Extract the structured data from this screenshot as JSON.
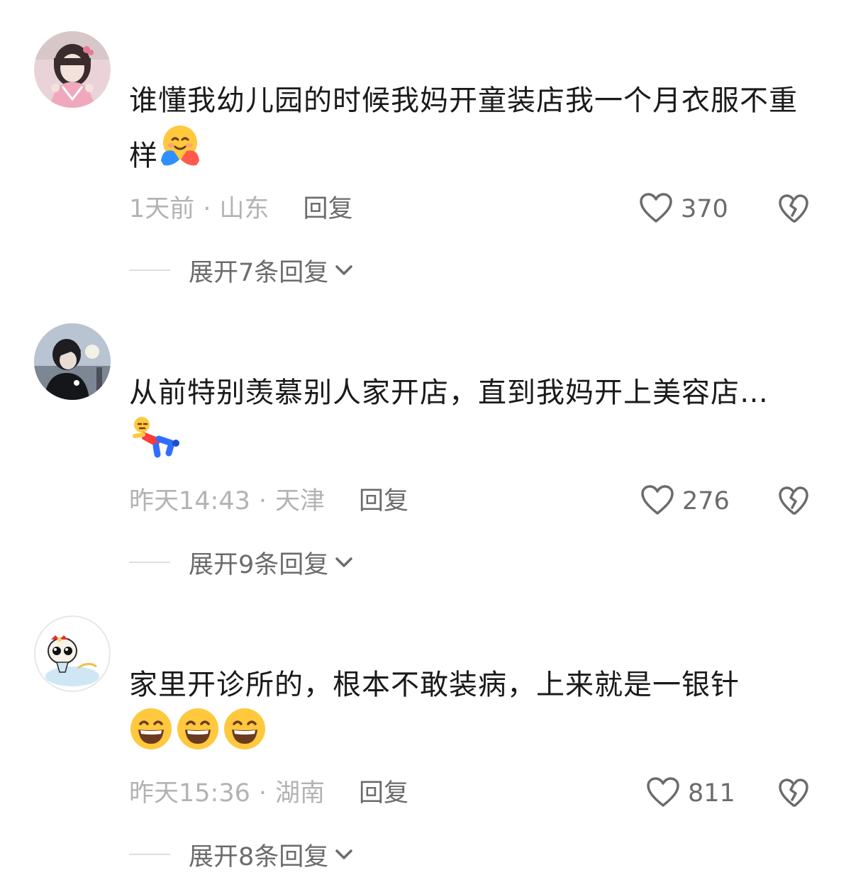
{
  "comments": [
    {
      "username": "",
      "text": "谁懂我幼儿园的时候我妈开童装店我一个月衣服不重样",
      "emojis": [
        "hugging-face-icon"
      ],
      "time": "1天前",
      "separator": "·",
      "location": "山东",
      "reply_label": "回复",
      "like_count": "370",
      "expand_label": "展开7条回复"
    },
    {
      "username": "",
      "text": "从前特别羡慕别人家开店，直到我妈开上美容店…",
      "emojis": [
        "lying-person-icon"
      ],
      "time": "昨天14:43",
      "separator": "·",
      "location": "天津",
      "reply_label": "回复",
      "like_count": "276",
      "expand_label": "展开9条回复"
    },
    {
      "username": "",
      "text": "家里开诊所的，根本不敢装病，上来就是一银针",
      "emojis": [
        "grinning-face-icon",
        "grinning-face-icon",
        "grinning-face-icon"
      ],
      "time": "昨天15:36",
      "separator": "·",
      "location": "湖南",
      "reply_label": "回复",
      "like_count": "811",
      "expand_label": "展开8条回复"
    }
  ],
  "colors": {
    "text": "#1a1a1a",
    "meta": "#b3b3b3",
    "secondary": "#6b6b6b",
    "divider": "#dedede"
  }
}
